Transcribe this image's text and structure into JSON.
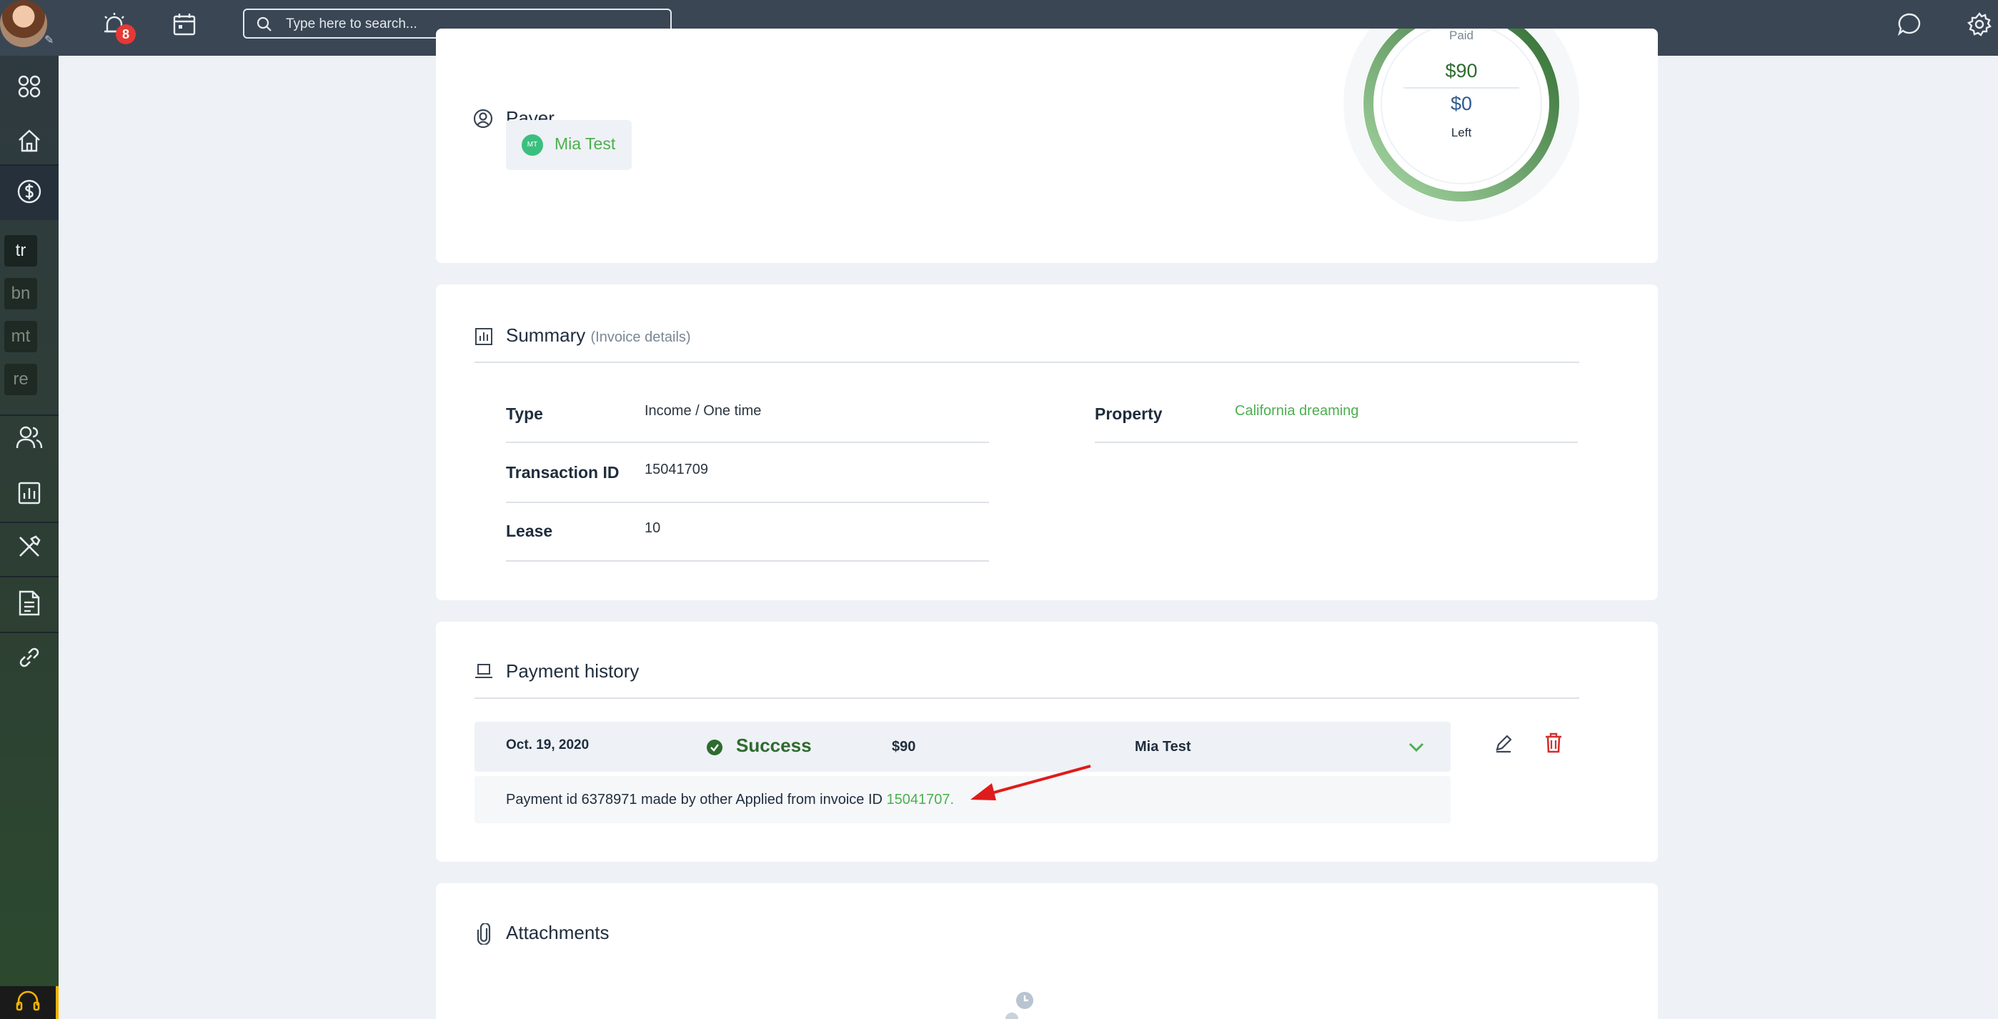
{
  "topbar": {
    "notification_count": "8",
    "search_placeholder": "Type here to search..."
  },
  "sidebar": {
    "tags": [
      "tr",
      "bn",
      "mt",
      "re"
    ]
  },
  "payer_card": {
    "title": "Payer",
    "payer_initials": "MT",
    "payer_name": "Mia Test",
    "ring": {
      "paid_label": "Paid",
      "paid_amount": "$90",
      "left_amount": "$0",
      "left_label": "Left",
      "paid_fraction": 1.0
    }
  },
  "summary": {
    "title": "Summary",
    "subtitle": "(Invoice details)",
    "fields": [
      {
        "label": "Type",
        "value": "Income / One time"
      },
      {
        "label": "Transaction ID",
        "value": "15041709"
      },
      {
        "label": "Lease",
        "value": "10"
      }
    ],
    "property_label": "Property",
    "property_value": "California dreaming"
  },
  "payment_history": {
    "title": "Payment history",
    "rows": [
      {
        "date": "Oct. 19, 2020",
        "status": "Success",
        "amount": "$90",
        "payer": "Mia Test",
        "note_prefix": "Payment id 6378971 made by other Applied from invoice ID",
        "note_link": "15041707."
      }
    ]
  },
  "attachments": {
    "title": "Attachments"
  },
  "colors": {
    "topbar": "#3a4654",
    "accent_green": "#4caf50",
    "dark_green": "#2e6b2f",
    "delete_red": "#d32f2f",
    "arrow_red": "#e01b1b"
  }
}
